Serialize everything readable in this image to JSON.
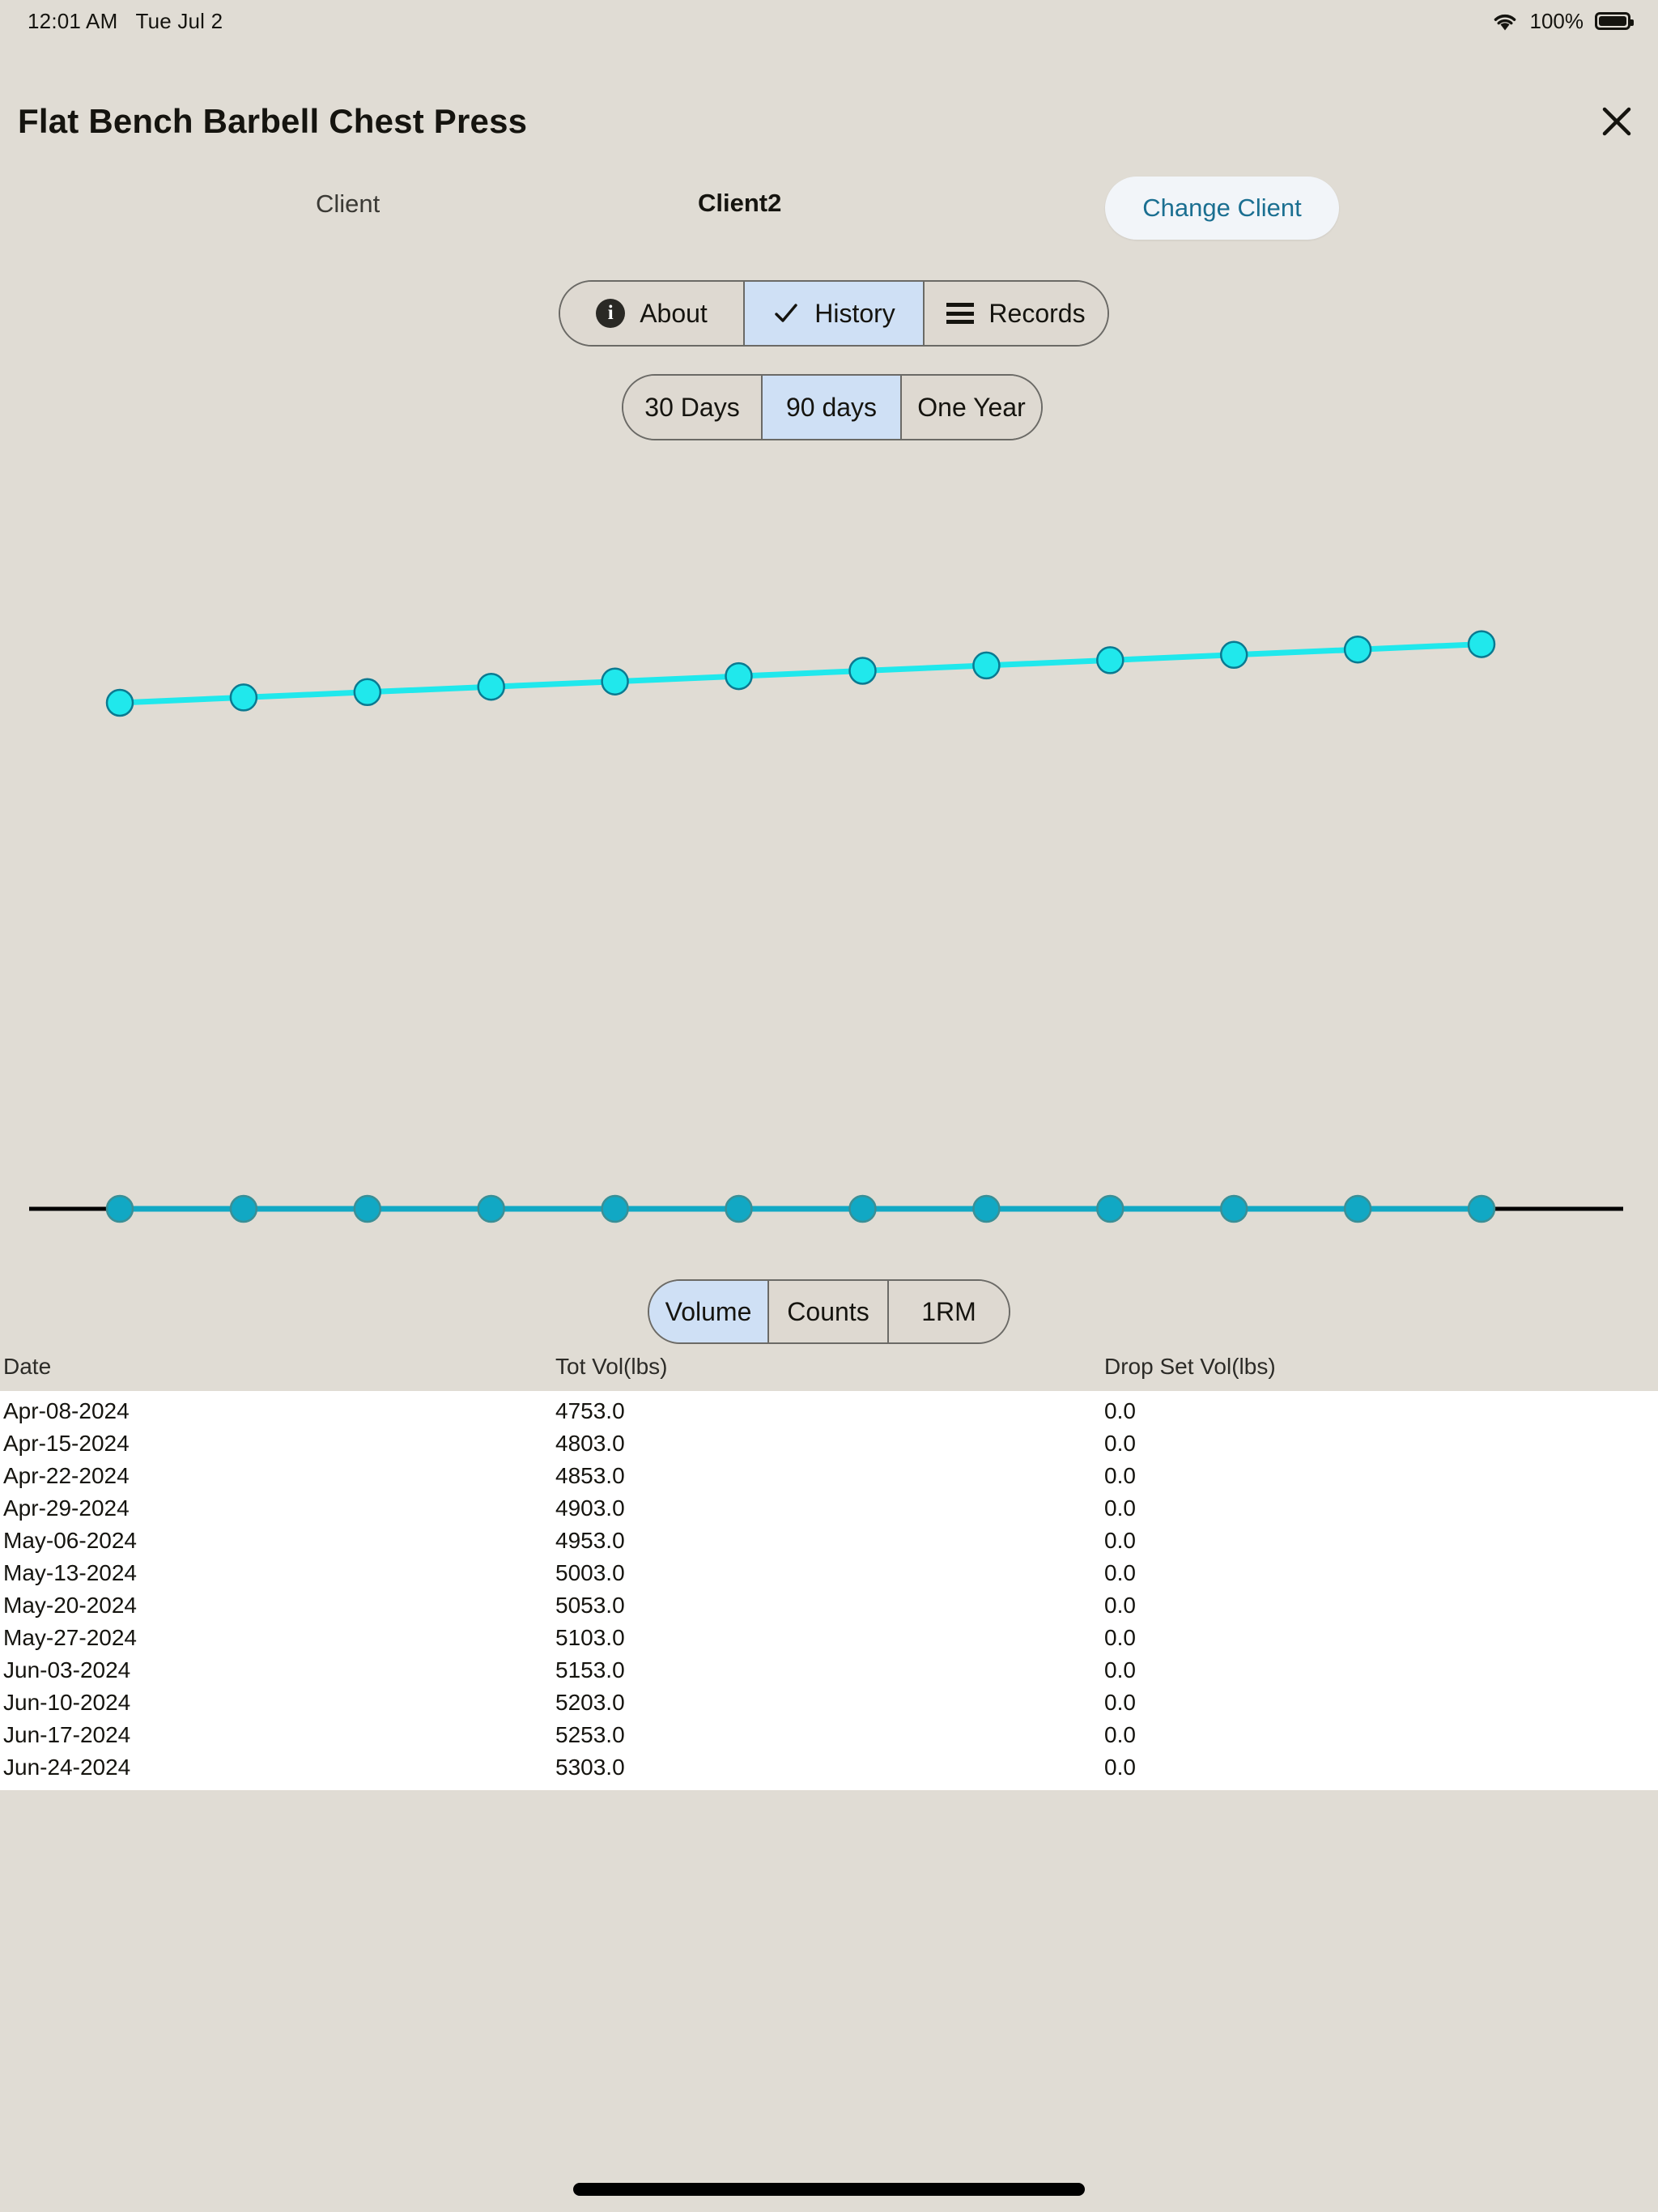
{
  "status_bar": {
    "time": "12:01 AM",
    "date": "Tue Jul 2",
    "battery_percent": "100%",
    "wifi_icon": "wifi-icon",
    "battery_icon": "battery-full-icon"
  },
  "header": {
    "title": "Flat Bench Barbell Chest Press",
    "close_icon": "close-icon"
  },
  "client": {
    "label": "Client",
    "value": "Client2",
    "change_button": "Change Client"
  },
  "tabs": [
    {
      "label": "About",
      "icon": "info-circle-icon",
      "selected": false
    },
    {
      "label": "History",
      "icon": "check-icon",
      "selected": true
    },
    {
      "label": "Records",
      "icon": "list-icon",
      "selected": false
    }
  ],
  "range_options": [
    {
      "label": "30 Days",
      "selected": false
    },
    {
      "label": "90 days",
      "selected": true
    },
    {
      "label": "One Year",
      "selected": false
    }
  ],
  "metric_options": [
    {
      "label": "Volume",
      "selected": true
    },
    {
      "label": "Counts",
      "selected": false
    },
    {
      "label": "1RM",
      "selected": false
    }
  ],
  "colors": {
    "background": "#e0dcd4",
    "selected_segment": "#cfe0f5",
    "accent_link": "#1b6f91",
    "series_total_volume": "#20e8ec",
    "series_drop_set_volume": "#11a8c4",
    "axis": "#000000"
  },
  "chart_data": {
    "type": "line",
    "title": "",
    "xlabel": "",
    "ylabel": "",
    "grid": false,
    "legend": "none",
    "x": [
      "Apr-08-2024",
      "Apr-15-2024",
      "Apr-22-2024",
      "Apr-29-2024",
      "May-06-2024",
      "May-13-2024",
      "May-20-2024",
      "May-27-2024",
      "Jun-03-2024",
      "Jun-10-2024",
      "Jun-17-2024",
      "Jun-24-2024"
    ],
    "ylim": [
      0,
      5650
    ],
    "series": [
      {
        "name": "Tot Vol(lbs)",
        "color": "#20e8ec",
        "values": [
          4753.0,
          4803.0,
          4853.0,
          4903.0,
          4953.0,
          5003.0,
          5053.0,
          5103.0,
          5153.0,
          5203.0,
          5253.0,
          5303.0
        ]
      },
      {
        "name": "Drop Set Vol(lbs)",
        "color": "#11a8c4",
        "values": [
          0.0,
          0.0,
          0.0,
          0.0,
          0.0,
          0.0,
          0.0,
          0.0,
          0.0,
          0.0,
          0.0,
          0.0
        ]
      }
    ]
  },
  "table": {
    "columns": [
      "Date",
      "Tot Vol(lbs)",
      "Drop Set Vol(lbs)"
    ],
    "rows": [
      [
        "Apr-08-2024",
        "4753.0",
        "0.0"
      ],
      [
        "Apr-15-2024",
        "4803.0",
        "0.0"
      ],
      [
        "Apr-22-2024",
        "4853.0",
        "0.0"
      ],
      [
        "Apr-29-2024",
        "4903.0",
        "0.0"
      ],
      [
        "May-06-2024",
        "4953.0",
        "0.0"
      ],
      [
        "May-13-2024",
        "5003.0",
        "0.0"
      ],
      [
        "May-20-2024",
        "5053.0",
        "0.0"
      ],
      [
        "May-27-2024",
        "5103.0",
        "0.0"
      ],
      [
        "Jun-03-2024",
        "5153.0",
        "0.0"
      ],
      [
        "Jun-10-2024",
        "5203.0",
        "0.0"
      ],
      [
        "Jun-17-2024",
        "5253.0",
        "0.0"
      ],
      [
        "Jun-24-2024",
        "5303.0",
        "0.0"
      ]
    ]
  }
}
